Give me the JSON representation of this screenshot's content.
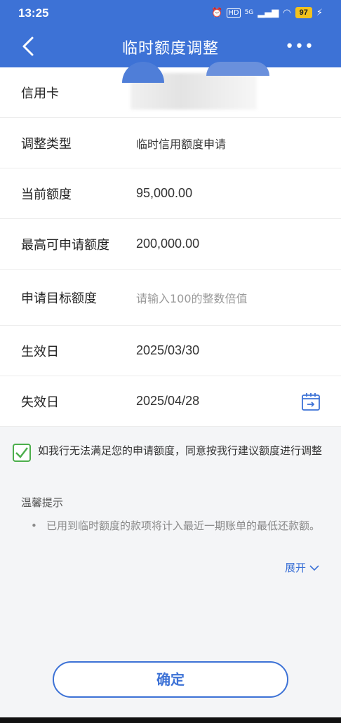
{
  "status_bar": {
    "time": "13:25",
    "battery": "97",
    "network": "5G"
  },
  "header": {
    "title": "临时额度调整"
  },
  "form": {
    "rows": [
      {
        "label": "信用卡",
        "value": ""
      },
      {
        "label": "调整类型",
        "value": "临时信用额度申请"
      },
      {
        "label": "当前额度",
        "value": "95,000.00"
      },
      {
        "label": "最高可申请额度",
        "value": "200,000.00"
      },
      {
        "label": "申请目标额度",
        "placeholder": "请输入100的整数倍值"
      },
      {
        "label": "生效日",
        "value": "2025/03/30"
      },
      {
        "label": "失效日",
        "value": "2025/04/28"
      }
    ]
  },
  "agreement": {
    "text": "如我行无法满足您的申请额度，同意按我行建议额度进行调整",
    "checked": true
  },
  "tips": {
    "title": "温馨提示",
    "items": [
      "已用到临时额度的款项将计入最近一期账单的最低还款额。"
    ],
    "expand_label": "展开"
  },
  "confirm_button": {
    "label": "确定"
  },
  "colors": {
    "primary": "#3d72d6",
    "check": "#4cae4c"
  }
}
